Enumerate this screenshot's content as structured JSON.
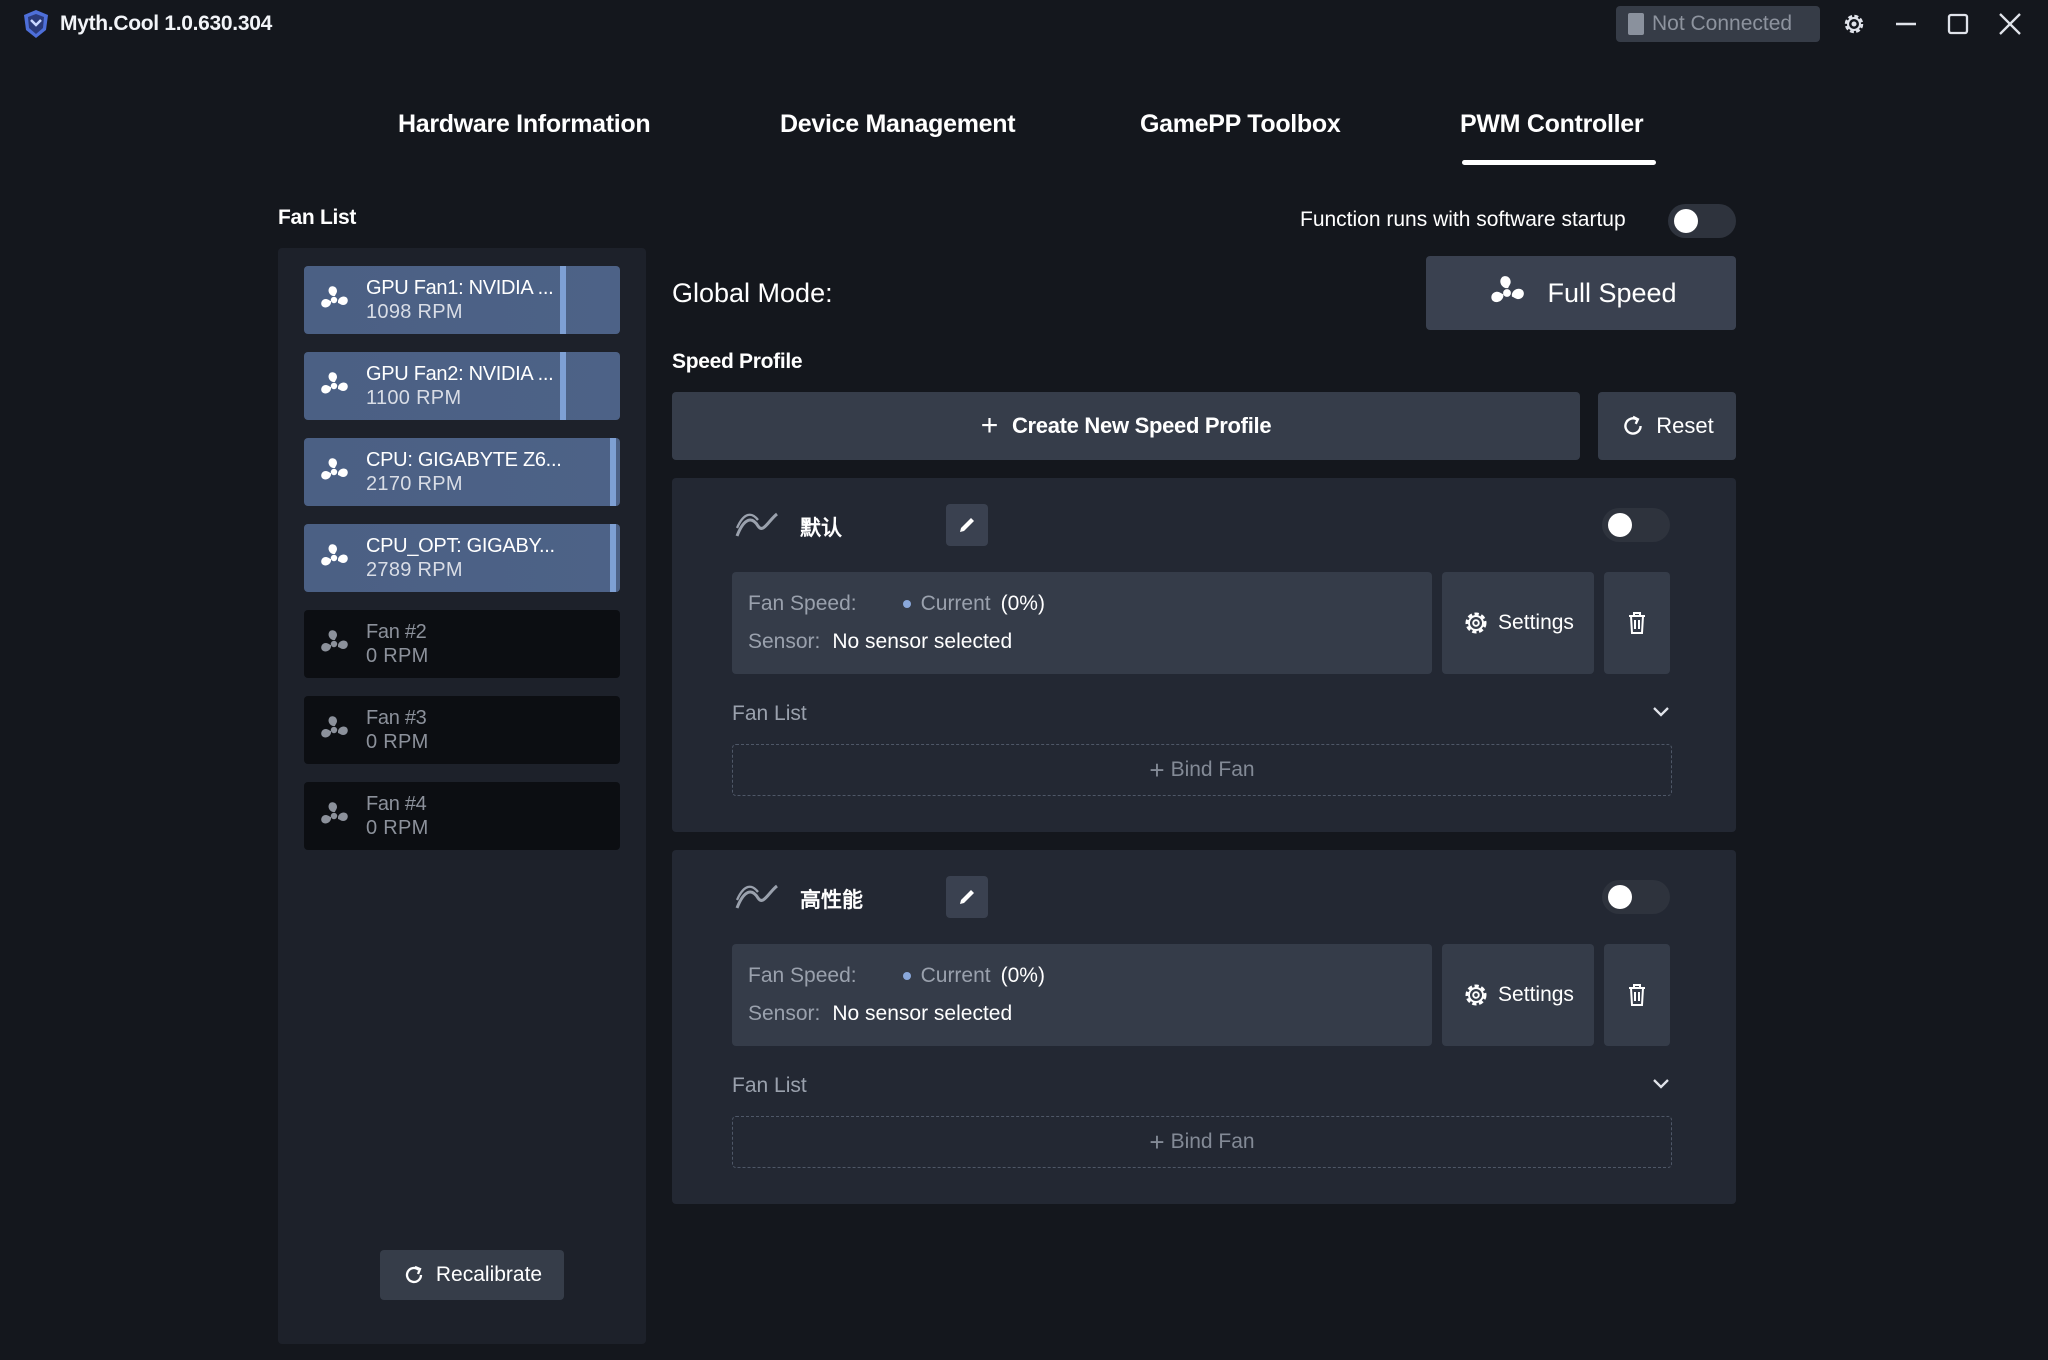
{
  "app": {
    "title": "Myth.Cool 1.0.630.304",
    "connection_status": "Not Connected"
  },
  "tabs": [
    {
      "label": "Hardware Information",
      "active": false
    },
    {
      "label": "Device Management",
      "active": false
    },
    {
      "label": "GamePP Toolbox",
      "active": false
    },
    {
      "label": "PWM Controller",
      "active": true
    }
  ],
  "fan_list": {
    "title": "Fan List",
    "items": [
      {
        "name": "GPU Fan1: NVIDIA ...",
        "rpm": "1098 RPM",
        "active": true
      },
      {
        "name": "GPU Fan2: NVIDIA ...",
        "rpm": "1100 RPM",
        "active": true
      },
      {
        "name": "CPU: GIGABYTE Z6...",
        "rpm": "2170 RPM",
        "active": true
      },
      {
        "name": "CPU_OPT: GIGABY...",
        "rpm": "2789 RPM",
        "active": true
      },
      {
        "name": "Fan #2",
        "rpm": "0 RPM",
        "active": false
      },
      {
        "name": "Fan #3",
        "rpm": "0 RPM",
        "active": false
      },
      {
        "name": "Fan #4",
        "rpm": "0 RPM",
        "active": false
      }
    ],
    "recalibrate_label": "Recalibrate"
  },
  "startup": {
    "label": "Function runs with software startup",
    "enabled": false
  },
  "global_mode": {
    "label": "Global Mode:",
    "value": "Full Speed"
  },
  "speed_profile": {
    "title": "Speed Profile",
    "create_label": "Create New Speed Profile",
    "reset_label": "Reset",
    "profiles": [
      {
        "name": "默认",
        "enabled": false,
        "fan_speed_label": "Fan Speed:",
        "current_label": "Current",
        "current_value": "(0%)",
        "sensor_label": "Sensor:",
        "sensor_value": "No sensor selected",
        "settings_label": "Settings",
        "fan_list_label": "Fan List",
        "bind_fan_label": "Bind Fan"
      },
      {
        "name": "高性能",
        "enabled": false,
        "fan_speed_label": "Fan Speed:",
        "current_label": "Current",
        "current_value": "(0%)",
        "sensor_label": "Sensor:",
        "sensor_value": "No sensor selected",
        "settings_label": "Settings",
        "fan_list_label": "Fan List",
        "bind_fan_label": "Bind Fan"
      }
    ]
  },
  "colors": {
    "background": "#14171d",
    "panel": "#1d212a",
    "card": "#232833",
    "active_fan": "#4b6084",
    "accent": "#7ea0d4"
  },
  "icons": {
    "app_logo": "mythcool-logo-icon",
    "fan": "fan-icon",
    "settings": "gear-icon",
    "edit": "pencil-icon",
    "delete": "trash-icon",
    "reset": "refresh-icon",
    "curve": "curve-icon",
    "chevron": "chevron-down-icon"
  }
}
